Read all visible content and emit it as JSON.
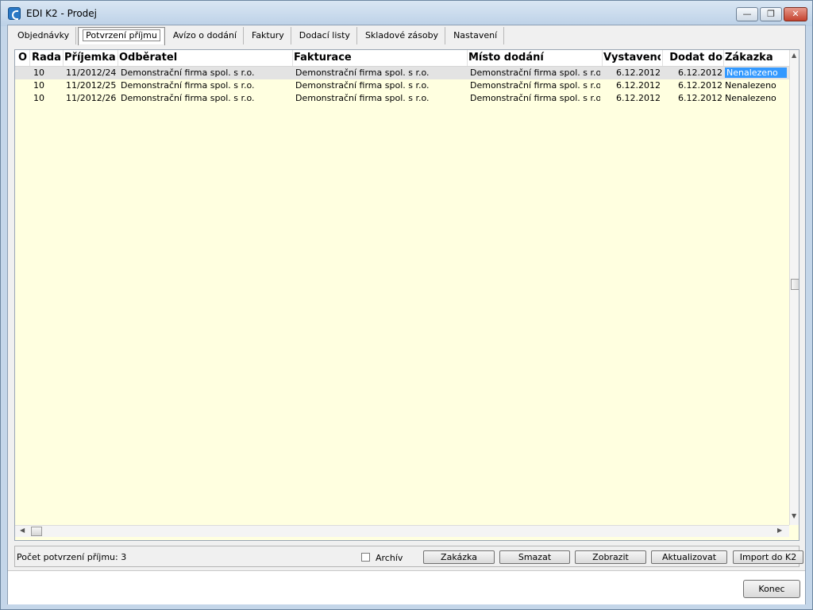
{
  "window": {
    "title": "EDI K2 - Prodej",
    "min_glyph": "—",
    "max_glyph": "❐",
    "close_glyph": "✕"
  },
  "tabs": [
    {
      "label": "Objednávky"
    },
    {
      "label": "Potvrzení příjmu",
      "active": true
    },
    {
      "label": "Avízo o dodání"
    },
    {
      "label": "Faktury"
    },
    {
      "label": "Dodací listy"
    },
    {
      "label": "Skladové zásoby"
    },
    {
      "label": "Nastavení"
    }
  ],
  "grid": {
    "columns": {
      "o": "O",
      "rada": "Řada",
      "prijemka": "Příjemka",
      "odberatel": "Odběratel",
      "fakturace": "Fakturace",
      "misto": "Místo dodání",
      "vystaveno": "Vystaveno",
      "dodat": "Dodat do",
      "zakazka": "Zákazka"
    },
    "rows": [
      {
        "rada": "10",
        "prijemka": "11/2012/24",
        "odberatel": "Demonstrační firma spol. s r.o.",
        "fakturace": "Demonstrační firma spol. s r.o.",
        "misto": "Demonstrační firma spol. s r.o.",
        "vystaveno": "6.12.2012",
        "dodat": "6.12.2012",
        "zakazka": "Nenalezeno"
      },
      {
        "rada": "10",
        "prijemka": "11/2012/25",
        "odberatel": "Demonstrační firma spol. s r.o.",
        "fakturace": "Demonstrační firma spol. s r.o.",
        "misto": "Demonstrační firma spol. s r.o.",
        "vystaveno": "6.12.2012",
        "dodat": "6.12.2012",
        "zakazka": "Nenalezeno"
      },
      {
        "rada": "10",
        "prijemka": "11/2012/26",
        "odberatel": "Demonstrační firma spol. s r.o.",
        "fakturace": "Demonstrační firma spol. s r.o.",
        "misto": "Demonstrační firma spol. s r.o.",
        "vystaveno": "6.12.2012",
        "dodat": "6.12.2012",
        "zakazka": "Nenalezeno"
      }
    ]
  },
  "status": {
    "count_label": "Počet potvrzení příjmu: 3",
    "archiv_label": "Archív",
    "archiv_checked": false
  },
  "buttons": {
    "zakazka": "Zakázka",
    "smazat": "Smazat",
    "zobrazit": "Zobrazit",
    "aktualizovat": "Aktualizovat",
    "import": "Import do K2",
    "konec": "Konec"
  },
  "colors": {
    "grid_bg": "#ffffe0",
    "selection": "#3399ff"
  }
}
